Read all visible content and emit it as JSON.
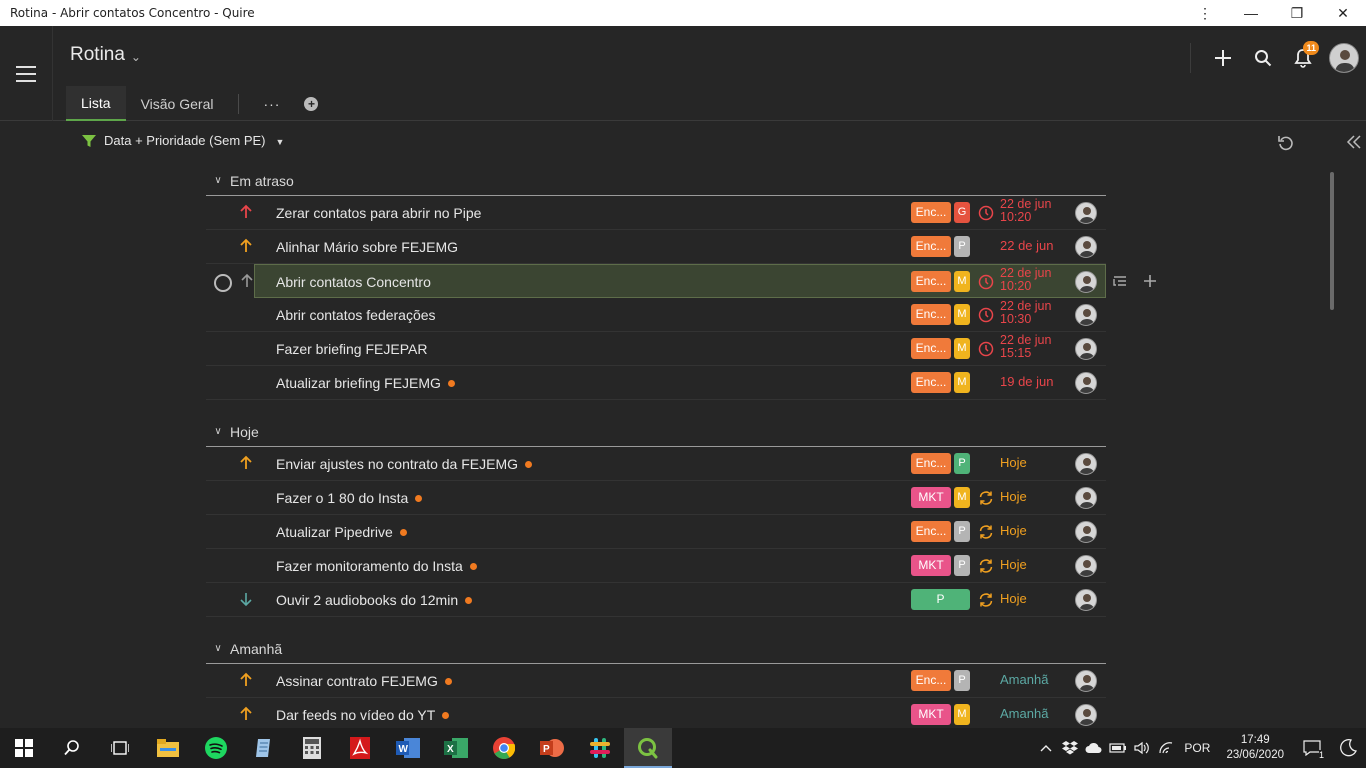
{
  "window": {
    "title": "Rotina - Abrir contatos Concentro - Quire"
  },
  "header": {
    "project_title": "Rotina",
    "tabs": [
      {
        "label": "Lista",
        "active": true
      },
      {
        "label": "Visão Geral",
        "active": false
      }
    ],
    "more_label": "···",
    "notification_count": "11"
  },
  "filter": {
    "label": "Data + Prioridade (Sem PE)"
  },
  "sections": [
    {
      "label": "Em atraso"
    },
    {
      "label": "Hoje"
    },
    {
      "label": "Amanhã"
    }
  ],
  "tasks": [
    {
      "name": "Zerar contatos para abrir no Pipe",
      "priority": "high-red",
      "tag1": "Enc...",
      "tag2": "G",
      "date_line1": "22 de jun",
      "date_line2": "10:20",
      "date_icon": "clock-icon",
      "date_color": "#e8454a",
      "dot": false
    },
    {
      "name": "Alinhar Mário sobre FEJEMG",
      "priority": "high-orange",
      "tag1": "Enc...",
      "tag2": "P",
      "date_line1": "22 de jun",
      "date_line2": "",
      "date_icon": "",
      "date_color": "#e8454a",
      "dot": false
    },
    {
      "name": "Abrir contatos Concentro",
      "priority": "none",
      "tag1": "Enc...",
      "tag2": "M",
      "date_line1": "22 de jun",
      "date_line2": "10:20",
      "date_icon": "clock-icon",
      "date_color": "#e8454a",
      "dot": false,
      "selected": true
    },
    {
      "name": "Abrir contatos federações",
      "priority": "none",
      "tag1": "Enc...",
      "tag2": "M",
      "date_line1": "22 de jun",
      "date_line2": "10:30",
      "date_icon": "clock-icon",
      "date_color": "#e8454a",
      "dot": false
    },
    {
      "name": "Fazer briefing FEJEPAR",
      "priority": "none",
      "tag1": "Enc...",
      "tag2": "M",
      "date_line1": "22 de jun",
      "date_line2": "15:15",
      "date_icon": "clock-icon",
      "date_color": "#e8454a",
      "dot": false
    },
    {
      "name": "Atualizar briefing FEJEMG",
      "priority": "none",
      "tag1": "Enc...",
      "tag2": "M",
      "date_line1": "19 de jun",
      "date_line2": "",
      "date_icon": "",
      "date_color": "#e8454a",
      "dot": true
    },
    {
      "name": "Enviar ajustes no contrato da FEJEMG",
      "priority": "high-orange",
      "tag1": "Enc...",
      "tag2": "P",
      "date_line1": "Hoje",
      "date_line2": "",
      "date_icon": "",
      "date_color": "#f0a020",
      "dot": true
    },
    {
      "name": "Fazer o 1 80 do Insta",
      "priority": "none",
      "tag1": "MKT",
      "tag2": "M",
      "date_line1": "Hoje",
      "date_line2": "",
      "date_icon": "repeat-icon",
      "date_color": "#f0a020",
      "dot": true
    },
    {
      "name": "Atualizar Pipedrive",
      "priority": "none",
      "tag1": "Enc...",
      "tag2": "P",
      "date_line1": "Hoje",
      "date_line2": "",
      "date_icon": "repeat-icon",
      "date_color": "#f0a020",
      "dot": true
    },
    {
      "name": "Fazer monitoramento do Insta",
      "priority": "none",
      "tag1": "MKT",
      "tag2": "P",
      "date_line1": "Hoje",
      "date_line2": "",
      "date_icon": "repeat-icon",
      "date_color": "#f0a020",
      "dot": true
    },
    {
      "name": "Ouvir 2 audiobooks do 12min",
      "priority": "low",
      "tag_wide": "P",
      "date_line1": "Hoje",
      "date_line2": "",
      "date_icon": "repeat-icon",
      "date_color": "#f0a020",
      "dot": true
    },
    {
      "name": "Assinar contrato FEJEMG",
      "priority": "high-orange",
      "tag1": "Enc...",
      "tag2": "P",
      "date_line1": "Amanhã",
      "date_line2": "",
      "date_icon": "",
      "date_color": "#5ca9a4",
      "dot": true
    },
    {
      "name": "Dar feeds no vídeo do YT",
      "priority": "high-orange",
      "tag1": "MKT",
      "tag2": "M",
      "date_line1": "Amanhã",
      "date_line2": "",
      "date_icon": "",
      "date_color": "#5ca9a4",
      "dot": true
    }
  ],
  "taskbar": {
    "apps": [
      "start-icon",
      "search-icon",
      "task-view-icon",
      "file-explorer-icon",
      "spotify-icon",
      "notepad-icon",
      "calculator-icon",
      "acrobat-icon",
      "word-icon",
      "excel-icon",
      "chrome-icon",
      "powerpoint-icon",
      "slack-icon",
      "quire-icon"
    ],
    "language": "POR",
    "time": "17:49",
    "date": "23/06/2020",
    "notification_count": "1"
  },
  "colors": {
    "accent_green": "#5ea64a",
    "overdue_red": "#e8454a",
    "today_orange": "#f0a020",
    "tomorrow_teal": "#5ca9a4"
  }
}
